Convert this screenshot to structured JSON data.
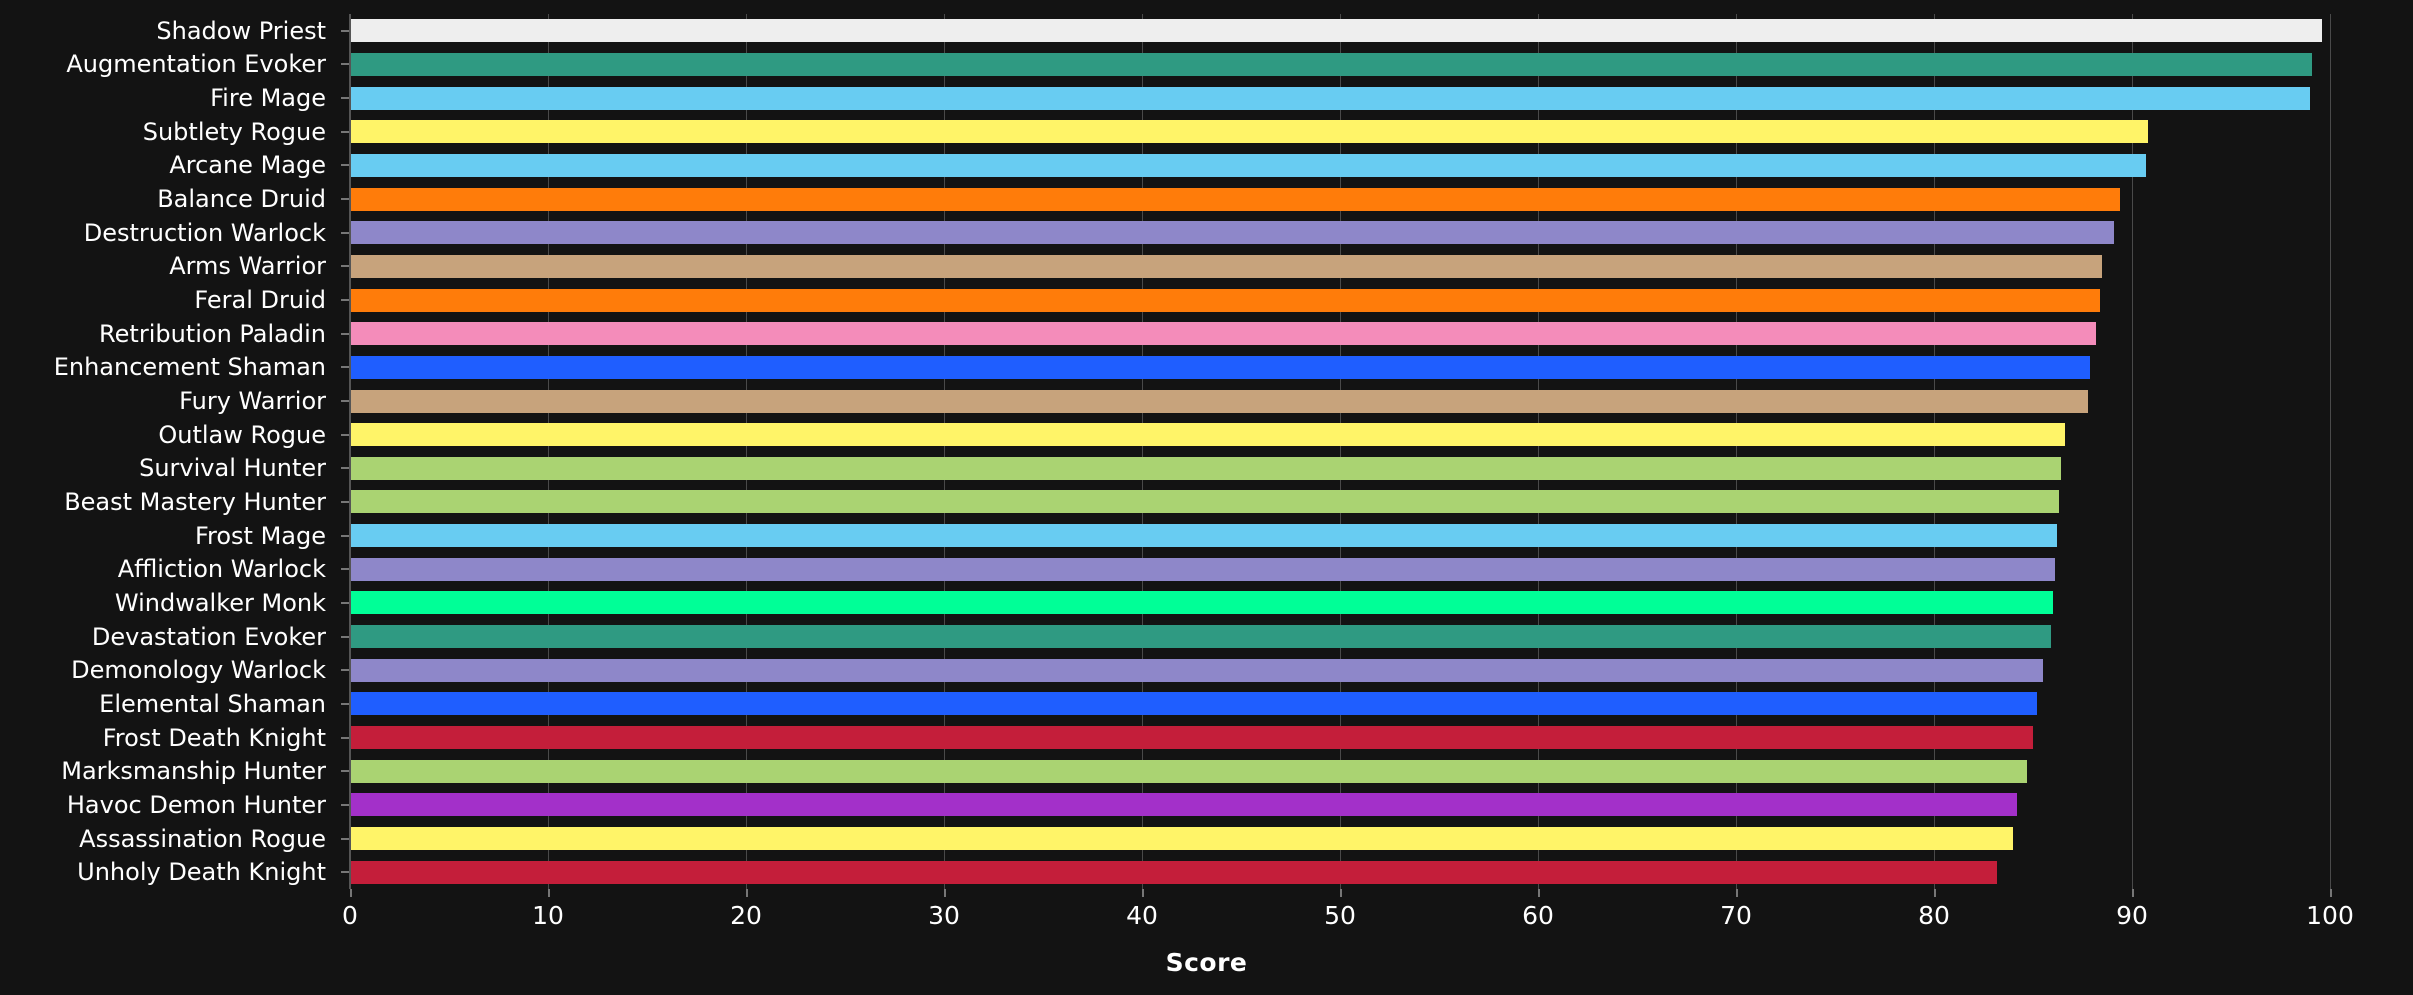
{
  "chart_data": {
    "type": "bar",
    "orientation": "horizontal",
    "title": "",
    "subtitle": "",
    "xlabel": "Score",
    "ylabel": "",
    "xlim": [
      0,
      100
    ],
    "ylim": null,
    "xticks": [
      0,
      10,
      20,
      30,
      40,
      50,
      60,
      70,
      80,
      90,
      100
    ],
    "xticklabels": [
      "0",
      "10",
      "20",
      "30",
      "40",
      "50",
      "60",
      "70",
      "80",
      "90",
      "100"
    ],
    "grid": "vertical",
    "legend": null,
    "background_color": "#131313",
    "text_color": "#ffffff",
    "gridline_color": "#4a4a4a",
    "categories": [
      "Shadow Priest",
      "Augmentation Evoker",
      "Fire Mage",
      "Subtlety Rogue",
      "Arcane Mage",
      "Balance Druid",
      "Destruction Warlock",
      "Arms Warrior",
      "Feral Druid",
      "Retribution Paladin",
      "Enhancement Shaman",
      "Fury Warrior",
      "Outlaw Rogue",
      "Survival Hunter",
      "Beast Mastery Hunter",
      "Frost Mage",
      "Affliction Warlock",
      "Windwalker Monk",
      "Devastation Evoker",
      "Demonology Warlock",
      "Elemental Shaman",
      "Frost Death Knight",
      "Marksmanship Hunter",
      "Havoc Demon Hunter",
      "Assassination Rogue",
      "Unholy Death Knight"
    ],
    "values": [
      99.6,
      99.1,
      99.0,
      90.8,
      90.7,
      89.4,
      89.1,
      88.5,
      88.4,
      88.2,
      87.9,
      87.8,
      86.6,
      86.4,
      86.3,
      86.2,
      86.1,
      86.0,
      85.9,
      85.5,
      85.2,
      85.0,
      84.7,
      84.2,
      84.0,
      83.2
    ],
    "colors": [
      "#eeeeee",
      "#2f9a82",
      "#68ccf2",
      "#fff468",
      "#68ccf2",
      "#ff7c0a",
      "#8e87c9",
      "#c7a37c",
      "#ff7c0a",
      "#f48cba",
      "#1f5eff",
      "#c7a37c",
      "#fff468",
      "#aad372",
      "#aad372",
      "#68ccf2",
      "#8e87c9",
      "#00ff97",
      "#2f9a82",
      "#8e87c9",
      "#1f5eff",
      "#c41e3a",
      "#aad372",
      "#a330c9",
      "#fff468",
      "#c41e3a"
    ]
  }
}
